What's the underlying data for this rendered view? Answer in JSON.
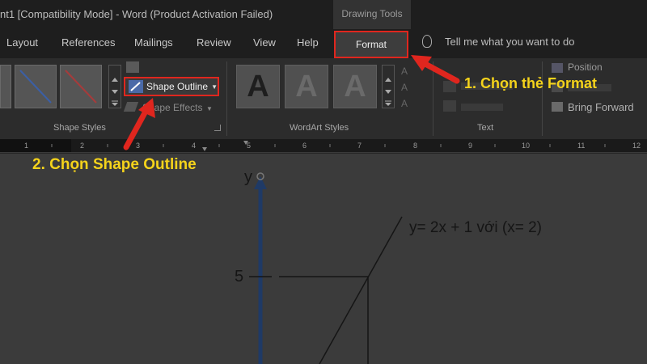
{
  "window": {
    "title": "nt1 [Compatibility Mode]  -  Word (Product Activation Failed)",
    "contextual_tab_group": "Drawing Tools"
  },
  "tabs": [
    "Layout",
    "References",
    "Mailings",
    "Review",
    "View",
    "Help"
  ],
  "active_tab": "Format",
  "tell_me": "Tell me what you want to do",
  "ribbon": {
    "shape_outline": "Shape Outline",
    "shape_effects": "Shape Effects",
    "shape_styles_label": "Shape Styles",
    "wordart_letters": [
      "A",
      "A",
      "A"
    ],
    "wordart_label": "WordArt Styles",
    "text_label": "Text",
    "position": "Position",
    "bring_forward": "Bring Forward"
  },
  "ruler_numbers": [
    "1",
    "2",
    "3",
    "4",
    "5",
    "6",
    "7",
    "8",
    "9",
    "10",
    "11",
    "12"
  ],
  "callouts": {
    "step1": "1. Chọn thẻ Format",
    "step2": "2. Chọn Shape Outline"
  },
  "document": {
    "axis_label": "y",
    "equation": "y= 2x + 1 với (x= 2)",
    "tick_value": "5"
  },
  "colors": {
    "highlight": "#e0261e",
    "callout_text": "#f5d31b",
    "axis_blue": "#1f3a66"
  }
}
